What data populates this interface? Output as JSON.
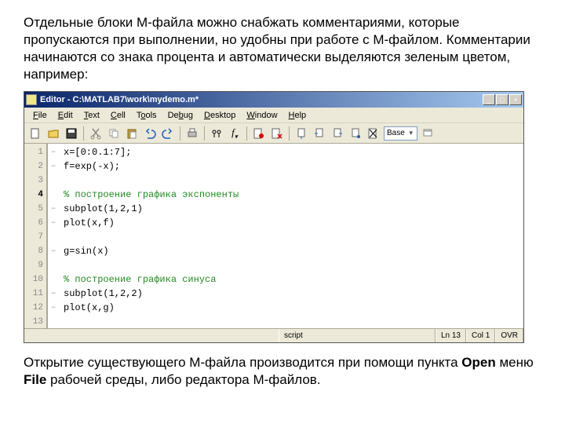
{
  "intro": "Отдельные блоки М-файла можно снабжать комментариями, которые пропускаются при выполнении, но удобны при работе с М-файлом. Комментарии начинаются со знака процента и автоматически выделяются зеленым цветом, например:",
  "outro_parts": {
    "p1": "Открытие существующего М-файла производится при помощи пункта ",
    "p2": "Open",
    "p3": " меню ",
    "p4": "File",
    "p5": " рабочей среды, либо редактора М-файлов."
  },
  "window": {
    "title": "Editor - C:\\MATLAB7\\work\\mydemo.m*"
  },
  "menu": [
    "File",
    "Edit",
    "Text",
    "Cell",
    "Tools",
    "Debug",
    "Desktop",
    "Window",
    "Help"
  ],
  "toolbar_dropdown": "Base",
  "code": {
    "lines": [
      {
        "n": 1,
        "dash": "–",
        "text": "x=[0:0.1:7];",
        "type": "code"
      },
      {
        "n": 2,
        "dash": "–",
        "text": "f=exp(-x);",
        "type": "code"
      },
      {
        "n": 3,
        "dash": "",
        "text": "",
        "type": "code"
      },
      {
        "n": 4,
        "dash": "",
        "text": "% построение графика экспоненты",
        "type": "comment",
        "bp": true
      },
      {
        "n": 5,
        "dash": "–",
        "text": "subplot(1,2,1)",
        "type": "code"
      },
      {
        "n": 6,
        "dash": "–",
        "text": "plot(x,f)",
        "type": "code"
      },
      {
        "n": 7,
        "dash": "",
        "text": "",
        "type": "code"
      },
      {
        "n": 8,
        "dash": "–",
        "text": "g=sin(x)",
        "type": "code"
      },
      {
        "n": 9,
        "dash": "",
        "text": "",
        "type": "code"
      },
      {
        "n": 10,
        "dash": "",
        "text": "% построение графика синуса",
        "type": "comment"
      },
      {
        "n": 11,
        "dash": "–",
        "text": "subplot(1,2,2)",
        "type": "code"
      },
      {
        "n": 12,
        "dash": "–",
        "text": "plot(x,g)",
        "type": "code"
      },
      {
        "n": 13,
        "dash": "",
        "text": "",
        "type": "code"
      }
    ]
  },
  "status": {
    "type": "script",
    "ln_label": "Ln",
    "ln": "13",
    "col_label": "Col",
    "col": "1",
    "ovr": "OVR"
  }
}
